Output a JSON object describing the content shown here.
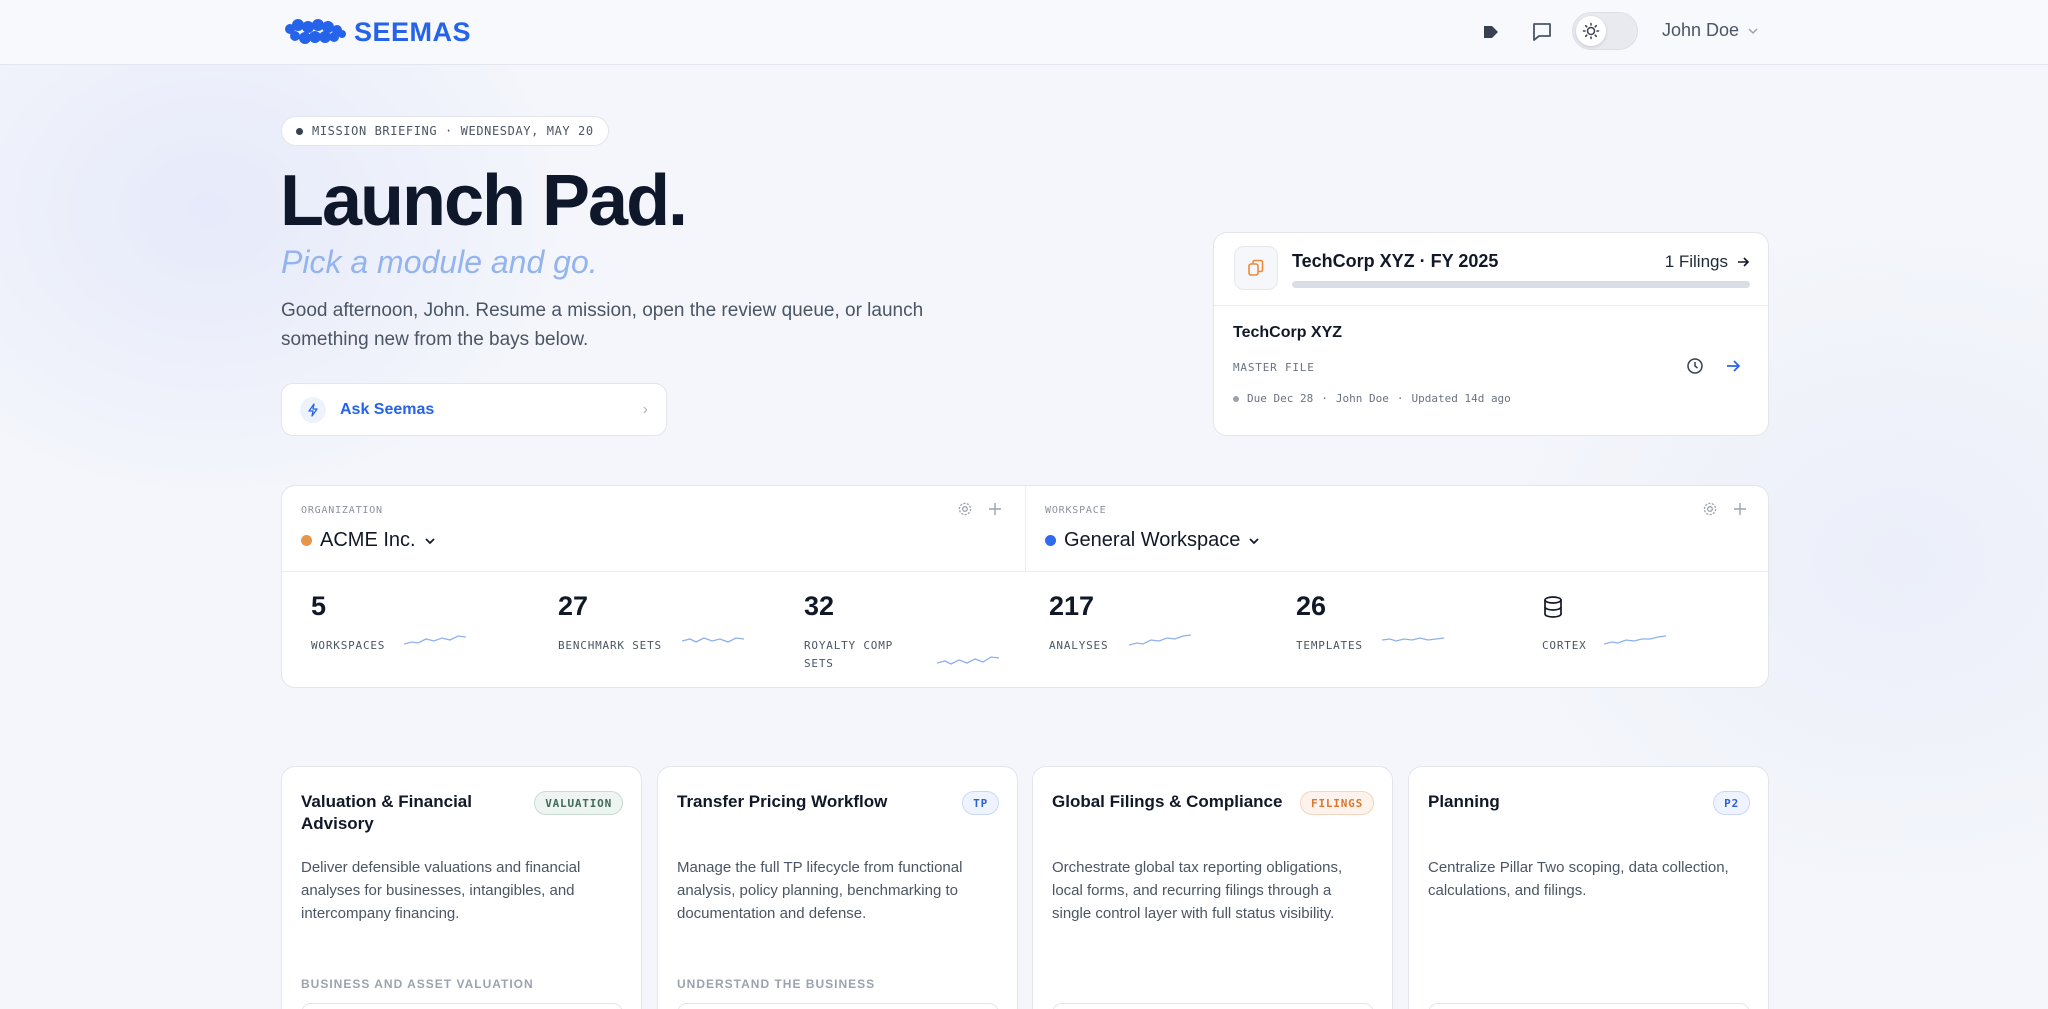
{
  "header": {
    "brand": "SEEMAS",
    "user_name": "John Doe",
    "icons": [
      "tag-icon",
      "chat-icon",
      "sun-icon",
      "chevron-down-icon"
    ]
  },
  "hero": {
    "briefing": "MISSION BRIEFING · WEDNESDAY, MAY 20",
    "title": "Launch Pad.",
    "subtitle": "Pick a module and go.",
    "description": "Good afternoon, John. Resume a mission, open the review queue, or launch something new from the bays below.",
    "ask_label": "Ask Seemas"
  },
  "filing_card": {
    "title": "TechCorp XYZ · FY 2025",
    "count": "1 Filings",
    "company": "TechCorp XYZ",
    "type": "MASTER FILE",
    "due": "Due Dec 28",
    "owner": "John Doe",
    "updated": "Updated 14d ago",
    "sep": "·"
  },
  "org_panel": {
    "org_label": "ORGANIZATION",
    "org_value": "ACME Inc.",
    "ws_label": "WORKSPACE",
    "ws_value": "General Workspace",
    "stats": [
      {
        "value": "5",
        "label": "WORKSPACES"
      },
      {
        "value": "27",
        "label": "BENCHMARK SETS"
      },
      {
        "value": "32",
        "label": "ROYALTY COMP SETS"
      },
      {
        "value": "217",
        "label": "ANALYSES"
      },
      {
        "value": "26",
        "label": "TEMPLATES"
      },
      {
        "value": "",
        "label": "CORTEX"
      }
    ]
  },
  "modules": [
    {
      "title": "Valuation & Financial Advisory",
      "badge": "VALUATION",
      "description": "Deliver defensible valuations and financial analyses for businesses, intangibles, and intercompany financing.",
      "section": "BUSINESS AND ASSET VALUATION"
    },
    {
      "title": "Transfer Pricing Workflow",
      "badge": "TP",
      "description": "Manage the full TP lifecycle from functional analysis, policy planning, benchmarking to documentation and defense.",
      "section": "UNDERSTAND THE BUSINESS"
    },
    {
      "title": "Global Filings & Compliance",
      "badge": "FILINGS",
      "description": "Orchestrate global tax reporting obligations, local forms, and recurring filings through a single control layer with full status visibility.",
      "section": ""
    },
    {
      "title": "Planning",
      "badge": "P2",
      "description": "Centralize Pillar Two scoping, data collection, calculations, and filings.",
      "section": ""
    }
  ],
  "colors": {
    "accent": "#2563eb",
    "org_dot": "#e8954a",
    "ws_dot": "#2f6bf0",
    "badge_valuation_bg": "#eef4f1",
    "badge_tp_bg": "#eef3fe",
    "badge_filings_bg": "#fdf3ec",
    "badge_p2_bg": "#eef3fe"
  }
}
